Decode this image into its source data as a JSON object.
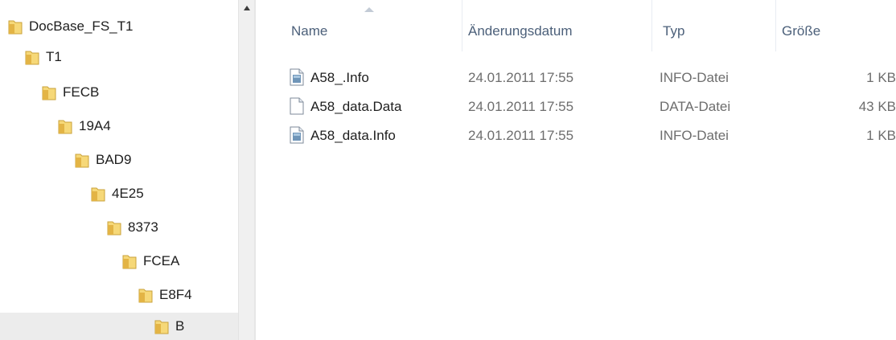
{
  "nav": {
    "items": [
      {
        "label": "DocBase_FS_T1",
        "selected": false
      },
      {
        "label": "T1",
        "selected": false
      },
      {
        "label": "FECB",
        "selected": false
      },
      {
        "label": "19A4",
        "selected": false
      },
      {
        "label": "BAD9",
        "selected": false
      },
      {
        "label": "4E25",
        "selected": false
      },
      {
        "label": "8373",
        "selected": false
      },
      {
        "label": "FCEA",
        "selected": false
      },
      {
        "label": "E8F4",
        "selected": false
      },
      {
        "label": "B",
        "selected": true
      }
    ]
  },
  "columns": {
    "name": "Name",
    "date": "Änderungsdatum",
    "type": "Typ",
    "size": "Größe"
  },
  "files": [
    {
      "name": "A58_.Info",
      "date": "24.01.2011 17:55",
      "type": "INFO-Datei",
      "size": "1 KB",
      "icon": "info-file-icon"
    },
    {
      "name": "A58_data.Data",
      "date": "24.01.2011 17:55",
      "type": "DATA-Datei",
      "size": "43 KB",
      "icon": "blank-file-icon"
    },
    {
      "name": "A58_data.Info",
      "date": "24.01.2011 17:55",
      "type": "INFO-Datei",
      "size": "1 KB",
      "icon": "info-file-icon"
    }
  ],
  "colors": {
    "folder": "#e9c15a",
    "header_text": "#4c607a",
    "selected_bg": "#ececec"
  }
}
